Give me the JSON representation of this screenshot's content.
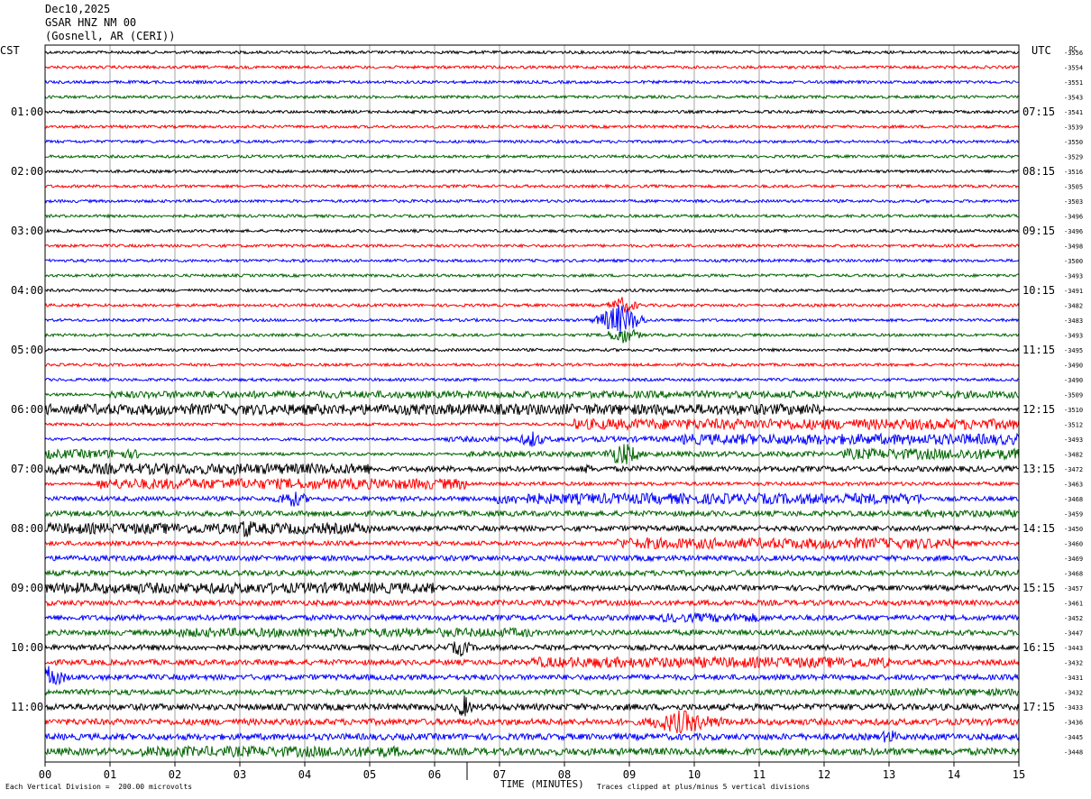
{
  "header": {
    "date": "Dec10,2025",
    "station": "GSAR HNZ NM 00",
    "location": "(Gosnell, AR (CERI))"
  },
  "labels": {
    "left_tz": "CST",
    "right_tz": "UTC",
    "dc": "DC",
    "xlabel": "TIME (MINUTES)",
    "scale_note": "Each Vertical Division =  200.00 microvolts",
    "clip_note": "Traces clipped at plus/minus 5 vertical divisions"
  },
  "colors": {
    "trace_cycle": [
      "#000000",
      "#ff0000",
      "#0000ff",
      "#006400"
    ],
    "grid": "#666666"
  },
  "chart_data": {
    "type": "helicorder",
    "xlim": [
      0,
      15
    ],
    "x_ticks": [
      "00",
      "01",
      "02",
      "03",
      "04",
      "05",
      "06",
      "07",
      "08",
      "09",
      "10",
      "11",
      "12",
      "13",
      "14",
      "15"
    ],
    "left_hour_labels": [
      "01:00",
      "02:00",
      "03:00",
      "04:00",
      "05:00",
      "06:00",
      "07:00",
      "08:00",
      "09:00",
      "10:00",
      "11:00"
    ],
    "right_hour_labels": [
      "07:15",
      "08:15",
      "09:15",
      "10:15",
      "11:15",
      "12:15",
      "13:15",
      "14:15",
      "15:15",
      "16:15",
      "17:15"
    ],
    "dc_values": [
      -3556,
      -3554,
      -3551,
      -3543,
      -3541,
      -3539,
      -3550,
      -3529,
      -3516,
      -3505,
      -3503,
      -3496,
      -3496,
      -3498,
      -3500,
      -3493,
      -3491,
      -3482,
      -3483,
      -3493,
      -3495,
      -3490,
      -3490,
      -3509,
      -3510,
      -3512,
      -3493,
      -3482,
      -3472,
      -3463,
      -3468,
      -3459,
      -3450,
      -3460,
      -3469,
      -3468,
      -3457,
      -3461,
      -3452,
      -3447,
      -3443,
      -3432,
      -3431,
      -3432,
      -3433,
      -3436,
      -3445,
      -3448
    ],
    "noise_segments": [
      [
        23,
        1.0,
        15,
        4
      ],
      [
        24,
        0,
        12,
        6
      ],
      [
        25,
        8.1,
        15,
        6
      ],
      [
        26,
        9.8,
        15,
        6
      ],
      [
        26,
        6.1,
        15,
        3
      ],
      [
        27,
        0,
        1.5,
        5
      ],
      [
        27,
        12.2,
        15,
        6
      ],
      [
        27,
        6.5,
        12,
        3
      ],
      [
        28,
        0,
        5,
        6
      ],
      [
        28,
        5,
        15,
        3
      ],
      [
        29,
        0.8,
        6.5,
        6
      ],
      [
        29,
        6.5,
        15,
        2
      ],
      [
        30,
        6.9,
        13.5,
        6
      ],
      [
        30,
        0,
        15,
        2.5
      ],
      [
        31,
        13.5,
        15,
        4
      ],
      [
        31,
        0,
        15,
        3
      ],
      [
        32,
        0,
        5,
        6
      ],
      [
        32,
        5,
        15,
        3
      ],
      [
        33,
        8.8,
        14,
        6
      ],
      [
        33,
        0,
        15,
        2.5
      ],
      [
        34,
        0,
        15,
        3
      ],
      [
        35,
        0,
        15,
        3
      ],
      [
        36,
        0,
        6,
        6
      ],
      [
        36,
        6,
        15,
        3
      ],
      [
        37,
        0,
        15,
        3
      ],
      [
        38,
        9.5,
        11,
        5
      ],
      [
        38,
        0,
        15,
        3
      ],
      [
        39,
        1.8,
        7.5,
        5
      ],
      [
        39,
        0,
        15,
        3
      ],
      [
        40,
        0,
        15,
        3
      ],
      [
        41,
        7.5,
        13,
        6
      ],
      [
        41,
        0,
        15,
        3
      ],
      [
        42,
        0,
        15,
        3
      ],
      [
        43,
        13,
        15,
        4
      ],
      [
        43,
        0,
        15,
        3
      ],
      [
        44,
        0,
        15,
        3.5
      ],
      [
        45,
        9.5,
        10.5,
        6
      ],
      [
        45,
        0,
        15,
        3.5
      ],
      [
        46,
        0,
        15,
        3.5
      ],
      [
        47,
        1.5,
        5.5,
        6
      ],
      [
        47,
        0,
        15,
        4
      ]
    ],
    "events": [
      [
        18,
        8.85,
        18,
        0.5
      ],
      [
        17,
        8.9,
        10,
        0.35
      ],
      [
        19,
        8.9,
        10,
        0.4
      ],
      [
        26,
        7.5,
        10,
        0.3
      ],
      [
        27,
        8.9,
        14,
        0.4
      ],
      [
        28,
        8.35,
        6,
        0.2
      ],
      [
        30,
        3.8,
        10,
        0.4
      ],
      [
        32,
        3.1,
        12,
        0.3
      ],
      [
        33,
        9.3,
        8,
        0.2
      ],
      [
        36,
        0.35,
        8,
        0.2
      ],
      [
        40,
        6.4,
        10,
        0.3
      ],
      [
        42,
        0.05,
        14,
        0.4
      ],
      [
        44,
        6.45,
        14,
        0.2
      ],
      [
        45,
        9.8,
        14,
        0.8
      ],
      [
        46,
        13.0,
        10,
        0.2
      ]
    ]
  }
}
